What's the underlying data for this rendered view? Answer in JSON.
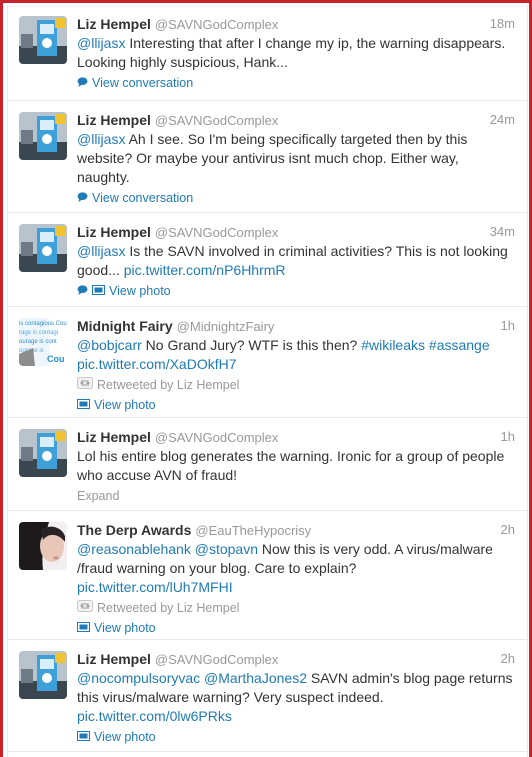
{
  "tweets": [
    {
      "name": "Liz Hempel",
      "handle": "@SAVNGodComplex",
      "time": "18m",
      "mention": "@llijasx",
      "text": " Interesting that after I change my ip, the warning disappears. Looking highly suspicious, Hank...",
      "action": "View conversation"
    },
    {
      "name": "Liz Hempel",
      "handle": "@SAVNGodComplex",
      "time": "24m",
      "mention": "@llijasx",
      "text": " Ah I see. So I'm being specifically targeted then by this website? Or maybe your antivirus isnt much chop. Either way, naughty.",
      "action": "View conversation"
    },
    {
      "name": "Liz Hempel",
      "handle": "@SAVNGodComplex",
      "time": "34m",
      "mention": "@llijasx",
      "text": " Is the SAVN involved in criminal activities? This is not looking good... ",
      "pic": "pic.twitter.com/nP6HhrmR",
      "action": "View photo"
    },
    {
      "name": "Midnight Fairy",
      "handle": "@MidnightzFairy",
      "time": "1h",
      "mention": "@bobjcarr",
      "text": " No Grand Jury? WTF is this then? ",
      "tag1": "#wikileaks",
      "tag2": "#assange",
      "pic": "pic.twitter.com/XaDOkfH7",
      "retweet": "Retweeted by Liz Hempel",
      "action": "View photo",
      "avatar_text": "is contagious Cou rage is contagi ourage is cont ourage is Cou"
    },
    {
      "name": "Liz Hempel",
      "handle": "@SAVNGodComplex",
      "time": "1h",
      "text": "Lol his entire blog generates the warning. Ironic for a group of people who accuse AVN of fraud!",
      "expand": "Expand"
    },
    {
      "name": "The Derp Awards",
      "handle": "@EauTheHypocrisy",
      "time": "2h",
      "mention": "@reasonablehank",
      "mention2": "@stopavn",
      "text": " Now this is very odd. A virus/malware /fraud warning on your blog. Care to explain?",
      "pic": "pic.twitter.com/lUh7MFHI",
      "retweet": "Retweeted by Liz Hempel",
      "action": "View photo"
    },
    {
      "name": "Liz Hempel",
      "handle": "@SAVNGodComplex",
      "time": "2h",
      "mention": "@nocompulsoryvac",
      "mention2": "@MarthaJones2",
      "text": " SAVN admin's blog page returns this virus/malware warning? Very suspect indeed.",
      "pic": "pic.twitter.com/0lw6PRks",
      "action": "View photo"
    }
  ],
  "colors": {
    "link": "#1f7bb5",
    "muted": "#999999",
    "text": "#333333",
    "frame": "#c8232c"
  }
}
